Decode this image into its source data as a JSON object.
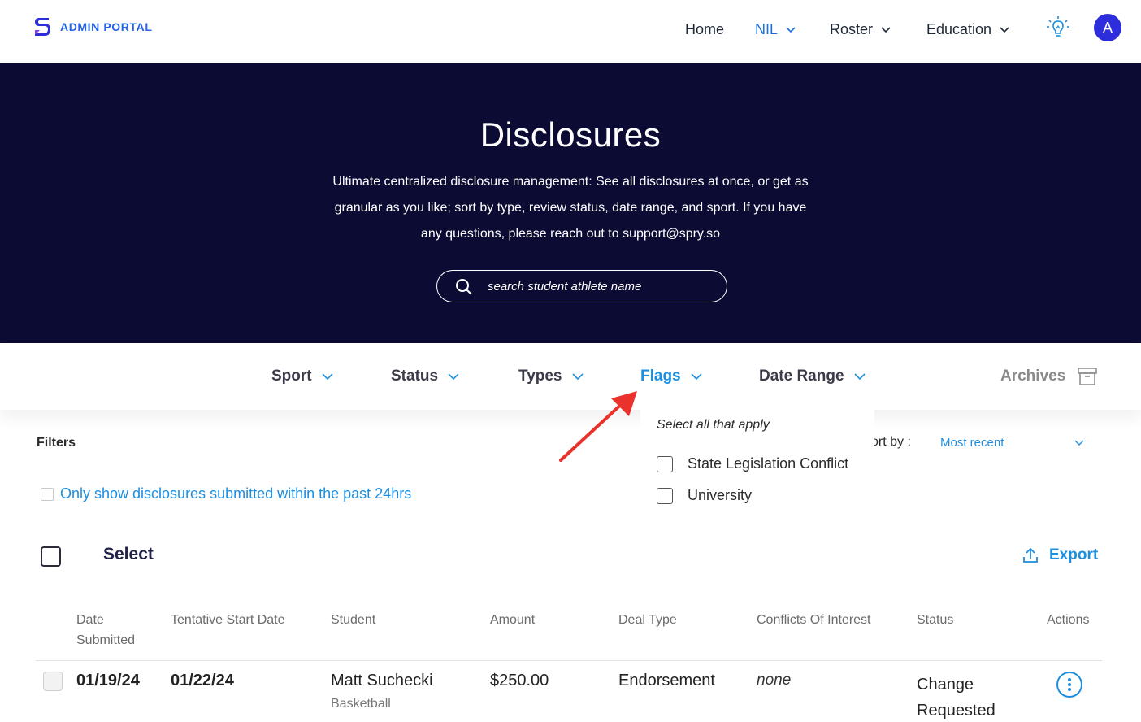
{
  "header": {
    "logo_text": "ADMIN PORTAL",
    "nav": [
      {
        "label": "Home"
      },
      {
        "label": "NIL"
      },
      {
        "label": "Roster"
      },
      {
        "label": "Education"
      }
    ],
    "avatar_initial": "A"
  },
  "hero": {
    "title": "Disclosures",
    "description": "Ultimate centralized disclosure management: See all disclosures at once, or get as granular as you like; sort by type, review status, date range, and sport. If you have any questions, please reach out to support@spry.so",
    "search_placeholder": "search student athlete name"
  },
  "filterbar": {
    "filters": [
      "Sport",
      "Status",
      "Types",
      "Flags",
      "Date Range"
    ],
    "archives_label": "Archives"
  },
  "flags_dropdown": {
    "title": "Select all that apply",
    "options": [
      "State Legislation Conflict",
      "University"
    ]
  },
  "controls": {
    "filters_label": "Filters",
    "past24_label": "Only show disclosures submitted within the past 24hrs",
    "sortby_label": "ort by :",
    "sortby_value": "Most recent",
    "select_label": "Select",
    "export_label": "Export"
  },
  "table": {
    "columns": [
      "Date Submitted",
      "Tentative Start Date",
      "Student",
      "Amount",
      "Deal Type",
      "Conflicts Of Interest",
      "Status",
      "Actions"
    ],
    "rows": [
      {
        "date_submitted": "01/19/24",
        "start_date": "01/22/24",
        "student": "Matt Suchecki",
        "sport": "Basketball",
        "amount": "$250.00",
        "deal_type": "Endorsement",
        "conflicts": "none",
        "status": "Change Requested"
      }
    ]
  },
  "colors": {
    "hero_bg": "#0c0b33",
    "accent_blue": "#1d8fe0",
    "nav_active": "#1d6fd8",
    "avatar_bg": "#2d2ddb",
    "arrow_red": "#e8322b"
  }
}
